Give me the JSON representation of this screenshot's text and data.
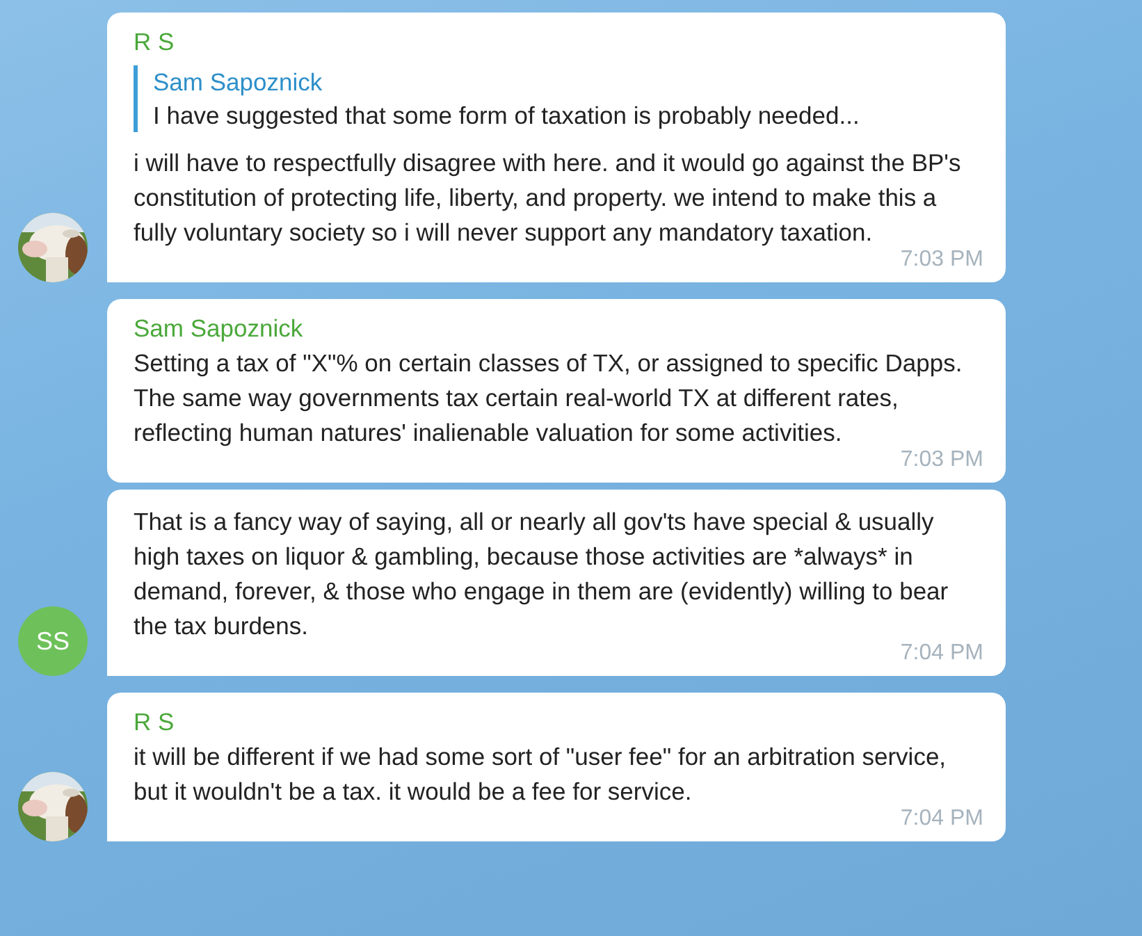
{
  "messages": [
    {
      "sender": "R S",
      "reply": {
        "author": "Sam Sapoznick",
        "text": "I have suggested that some form of taxation is probably needed..."
      },
      "text": "i will have to respectfully disagree with here. and it would go against the BP's constitution of protecting life, liberty, and property. we intend to make this a fully voluntary society so i will never support any mandatory taxation.",
      "time": "7:03 PM"
    },
    {
      "sender": "Sam Sapoznick",
      "text": "Setting a tax of \"X\"% on certain classes of TX, or assigned to specific Dapps. The same way governments tax certain real-world TX at different rates, reflecting human natures' inalienable valuation for some activities.",
      "time": "7:03 PM"
    },
    {
      "text": "That is a fancy way of saying, all or nearly all gov'ts have special & usually high taxes on liquor & gambling, because those activities are *always* in demand, forever, & those who engage in them are (evidently) willing to bear the tax burdens.",
      "time": "7:04 PM",
      "avatar": {
        "kind": "initials",
        "initials": "SS",
        "color": "#6ec15a"
      }
    },
    {
      "sender": "R S",
      "text": "it will be different if we had some sort of \"user fee\" for an arbitration service, but it wouldn't be a tax. it would be a fee for service.",
      "time": "7:04 PM"
    }
  ]
}
